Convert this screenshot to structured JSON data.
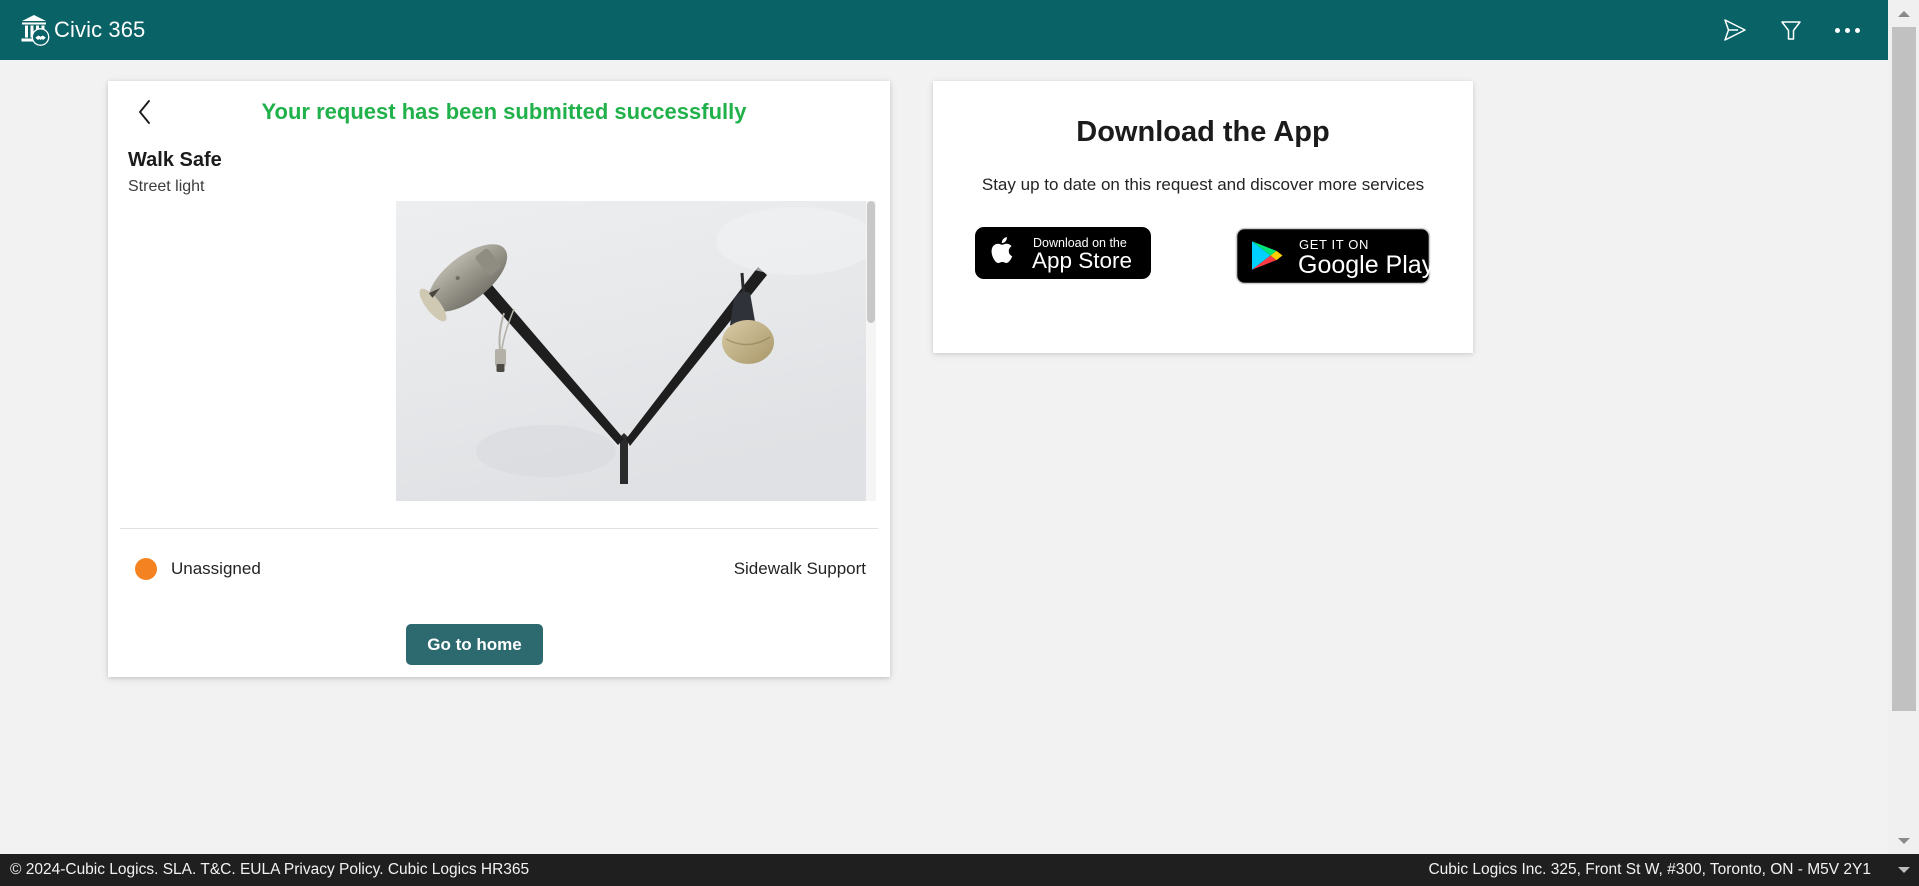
{
  "topbar": {
    "brand_name": "Civic 365",
    "logo_icon": "bank-handshake-icon",
    "actions": [
      {
        "icon": "send-icon",
        "name": "send-button"
      },
      {
        "icon": "filter-icon",
        "name": "filter-button"
      },
      {
        "icon": "ellipsis-icon",
        "name": "more-options-button"
      }
    ],
    "accent_color": "#086266"
  },
  "request_card": {
    "back_icon": "chevron-left-icon",
    "success_message": "Your request has been submitted successfully",
    "success_color": "#21b14b",
    "title": "Walk Safe",
    "subtitle": "Street light",
    "photo_alt": "street-light-photo",
    "status": {
      "dot_color": "#f58220",
      "label": "Unassigned",
      "team": "Sidewalk Support"
    },
    "primary_button": "Go to home",
    "primary_button_color": "#2d6a70"
  },
  "download_panel": {
    "title": "Download the App",
    "subtitle": "Stay up to date on this request and discover more services",
    "badges": [
      {
        "name": "app-store-badge",
        "small_text": "Download on the",
        "large_text": "App Store"
      },
      {
        "name": "google-play-badge",
        "small_text": "GET IT ON",
        "large_text": "Google Play"
      }
    ]
  },
  "footer": {
    "left": "© 2024-Cubic Logics. SLA. T&C. EULA Privacy Policy. Cubic Logics HR365",
    "right": "Cubic Logics Inc. 325, Front St W, #300, Toronto, ON - M5V 2Y1"
  }
}
